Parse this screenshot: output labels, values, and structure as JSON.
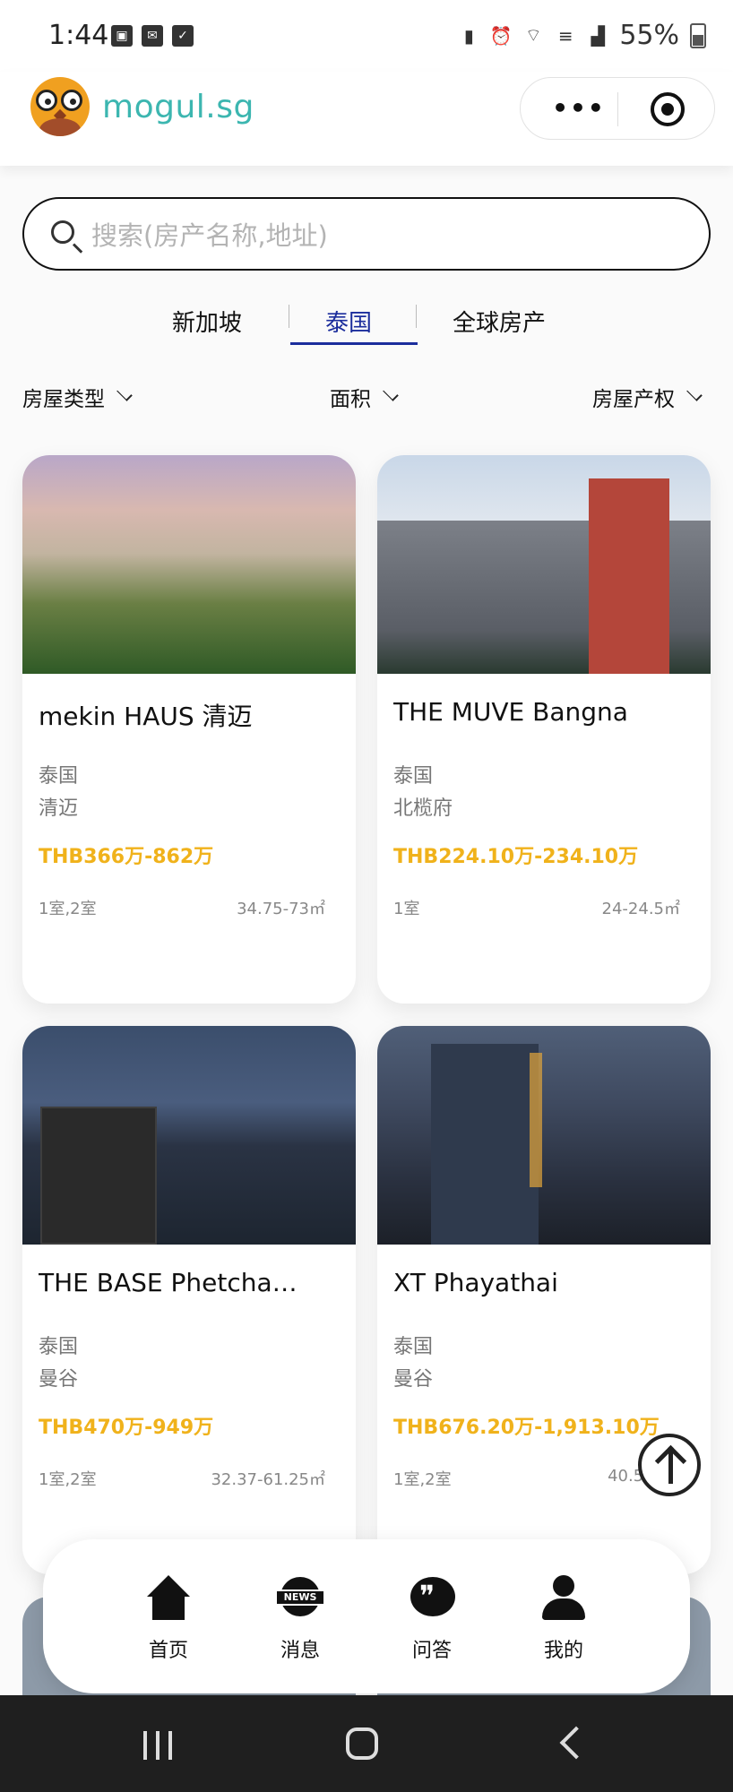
{
  "status_bar": {
    "time": "1:44",
    "battery": "55%"
  },
  "header": {
    "logo_text": "mogul.sg",
    "more_label": "•••"
  },
  "search": {
    "placeholder": "搜索(房产名称,地址)"
  },
  "tabs": [
    {
      "label": "新加坡",
      "active": false
    },
    {
      "label": "泰国",
      "active": true
    },
    {
      "label": "全球房产",
      "active": false
    }
  ],
  "filters": [
    {
      "label": "房屋类型"
    },
    {
      "label": "面积"
    },
    {
      "label": "房屋产权"
    }
  ],
  "listings": [
    {
      "name": "mekin HAUS 清迈",
      "country": "泰国",
      "city": "清迈",
      "price": "THB366万-862万",
      "rooms": "1室,2室",
      "area": "34.75-73㎡"
    },
    {
      "name": "THE MUVE Bangna",
      "country": "泰国",
      "city": "北榄府",
      "price": "THB224.10万-234.10万",
      "rooms": "1室",
      "area": "24-24.5㎡"
    },
    {
      "name": "THE BASE Phetcha…",
      "country": "泰国",
      "city": "曼谷",
      "price": "THB470万-949万",
      "rooms": "1室,2室",
      "area": "32.37-61.25㎡"
    },
    {
      "name": "XT Phayathai",
      "country": "泰国",
      "city": "曼谷",
      "price": "THB676.20万-1,913.10万",
      "rooms": "1室,2室",
      "area": "40.57-84"
    }
  ],
  "bottom_tabs": [
    {
      "label": "首页"
    },
    {
      "label": "消息"
    },
    {
      "label": "问答"
    },
    {
      "label": "我的"
    }
  ],
  "icons": {
    "news_badge": "NEWS"
  },
  "colors": {
    "accent": "#1b2d9c",
    "price": "#f0b21b",
    "brand": "#3cb6b0"
  }
}
